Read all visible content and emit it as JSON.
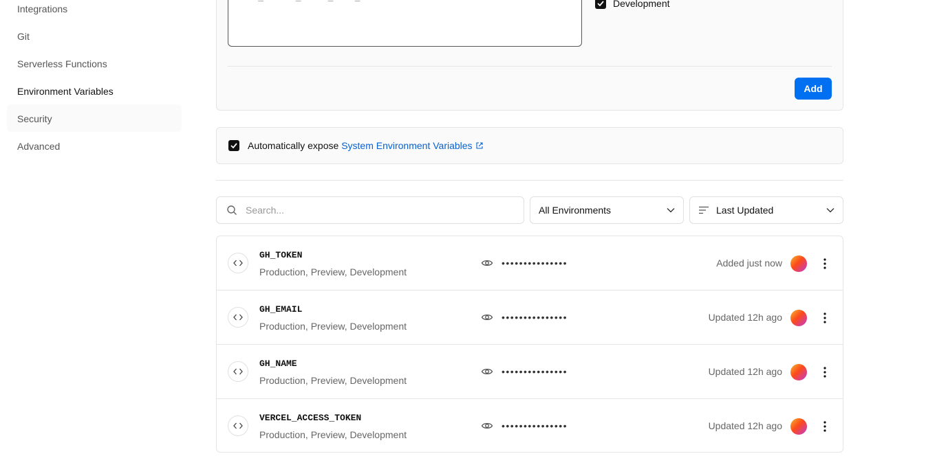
{
  "sidebar": {
    "items": [
      {
        "label": "Integrations",
        "active": false
      },
      {
        "label": "Git",
        "active": false
      },
      {
        "label": "Serverless Functions",
        "active": false
      },
      {
        "label": "Environment Variables",
        "active": true
      },
      {
        "label": "Security",
        "active": false
      },
      {
        "label": "Advanced",
        "active": false
      }
    ]
  },
  "form": {
    "value_placeholder": "YOUR_SECRET_VALUE_GOES_HERE",
    "env_checkbox_label": "Development",
    "add_label": "Add"
  },
  "expose": {
    "text": "Automatically expose",
    "link_text": "System Environment Variables"
  },
  "filters": {
    "search_placeholder": "Search...",
    "environment": "All Environments",
    "sort": "Last Updated"
  },
  "variables": [
    {
      "name": "GH_TOKEN",
      "environments": "Production, Preview, Development",
      "masked_value": "•••••••••••••••",
      "status": "Added just now"
    },
    {
      "name": "GH_EMAIL",
      "environments": "Production, Preview, Development",
      "masked_value": "•••••••••••••••",
      "status": "Updated 12h ago"
    },
    {
      "name": "GH_NAME",
      "environments": "Production, Preview, Development",
      "masked_value": "•••••••••••••••",
      "status": "Updated 12h ago"
    },
    {
      "name": "VERCEL_ACCESS_TOKEN",
      "environments": "Production, Preview, Development",
      "masked_value": "•••••••••••••••",
      "status": "Updated 12h ago"
    }
  ],
  "colors": {
    "accent": "#0070f3",
    "link": "#0761d1"
  },
  "icons": [
    "search-icon",
    "chevron-down-icon",
    "sort-lines-icon",
    "code-icon",
    "eye-icon",
    "more-vertical-icon",
    "external-link-icon",
    "checkmark-icon"
  ]
}
